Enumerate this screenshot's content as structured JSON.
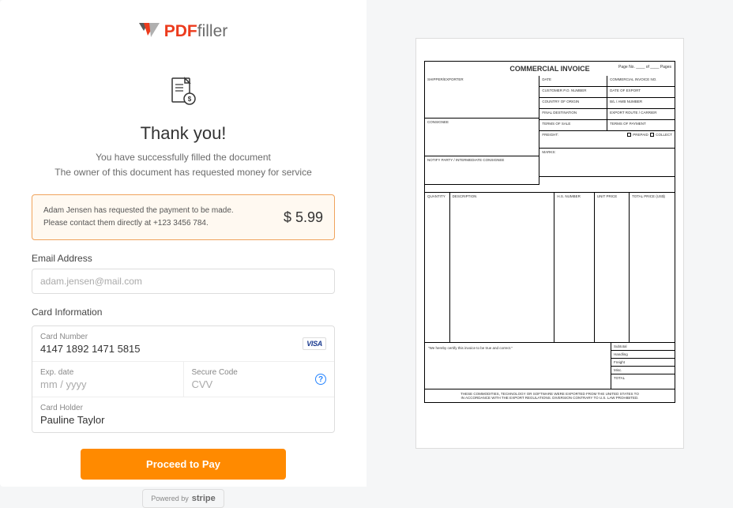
{
  "logo": {
    "pdf": "PDF",
    "filler": "filler"
  },
  "title": "Thank you!",
  "subtitle_line1": "You have successfully filled the document",
  "subtitle_line2": "The owner of this document has requested money for service",
  "notice": {
    "line1": "Adam Jensen has requested the payment to be made.",
    "line2": "Please contact them directly at +123 3456 784.",
    "amount": "$ 5.99"
  },
  "email": {
    "label": "Email Address",
    "placeholder": "adam.jensen@mail.com"
  },
  "card_info_label": "Card Information",
  "card": {
    "number_label": "Card Number",
    "number_value": "4147 1892 1471 5815",
    "visa": "VISA",
    "exp_label": "Exp. date",
    "exp_placeholder": "mm / yyyy",
    "cvv_label": "Secure Code",
    "cvv_placeholder": "CVV",
    "holder_label": "Card Holder",
    "holder_value": "Pauline Taylor"
  },
  "proceed_button": "Proceed to Pay",
  "stripe": {
    "powered_by": "Powered by",
    "name": "stripe"
  },
  "doc": {
    "title": "COMMERCIAL INVOICE",
    "page_no": "Page No. ____ of ____ Pages",
    "shipper": "Shipper/Exporter",
    "consignee": "Consignee",
    "notify": "Notify Party / Intermediate Consignee",
    "date": "Date",
    "invoice_no": "Commercial Invoice No.",
    "customer_po": "Customer P.O. Number",
    "date_export": "Date of Export",
    "country_origin": "Country of Origin",
    "bl_awb": "B/L / AWB Number",
    "final_dest": "Final Destination",
    "export_route": "Export Route / Carrier",
    "terms_sale": "Terms of Sale",
    "terms_payment": "Terms of Payment",
    "freight": "Freight:",
    "prepaid": "Prepaid",
    "collect": "Collect",
    "marks": "Marks:",
    "quantity": "Quantity",
    "description": "Description",
    "hs_number": "H.S. Number",
    "unit_price": "Unit Price",
    "total_price": "Total Price (US$)",
    "certify": "\"We hereby certify this invoice to be true and correct.\"",
    "subtotal": "Subtotal",
    "handling": "Handling",
    "freight2": "Freight",
    "misc": "Misc.",
    "total": "TOTAL",
    "footer1": "These commodities, technology or software were exported from the United States to",
    "footer2": "in accordance with the export regulations. Diversion contrary to U.S. law prohibited."
  }
}
